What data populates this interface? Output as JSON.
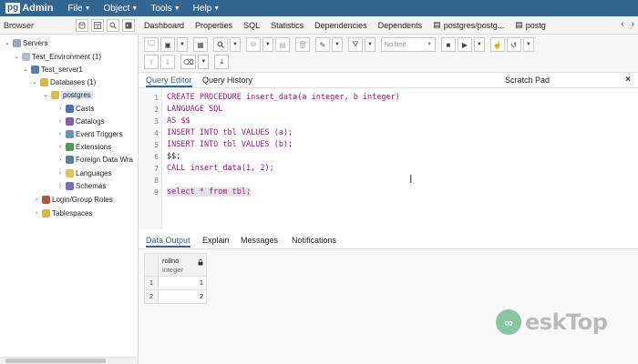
{
  "menubar": {
    "logo_pg": "pg",
    "logo_admin": "Admin",
    "items": [
      {
        "label": "File"
      },
      {
        "label": "Object"
      },
      {
        "label": "Tools"
      },
      {
        "label": "Help"
      }
    ]
  },
  "browser": {
    "title": "Browser",
    "tree": [
      {
        "label": "Servers"
      },
      {
        "label": "Test_Environment (1)"
      },
      {
        "label": "Test_server1"
      },
      {
        "label": "Databases (1)"
      },
      {
        "label": "postgres"
      },
      {
        "label": "Casts"
      },
      {
        "label": "Catalogs"
      },
      {
        "label": "Event Triggers"
      },
      {
        "label": "Extensions"
      },
      {
        "label": "Foreign Data Wra"
      },
      {
        "label": "Languages"
      },
      {
        "label": "Schemas"
      },
      {
        "label": "Login/Group Roles"
      },
      {
        "label": "Tablespaces"
      }
    ]
  },
  "tabbar": {
    "tabs": [
      {
        "label": "Dashboard"
      },
      {
        "label": "Properties"
      },
      {
        "label": "SQL"
      },
      {
        "label": "Statistics"
      },
      {
        "label": "Dependencies"
      },
      {
        "label": "Dependents"
      },
      {
        "label": "postgres/postg..."
      },
      {
        "label": "postg"
      }
    ]
  },
  "toolbar": {
    "limit_label": "No limit"
  },
  "query_tabs": {
    "editor": "Query Editor",
    "history": "Query History",
    "scratch": "Scratch Pad",
    "close": "×"
  },
  "editor": {
    "line_numbers": [
      "1",
      "2",
      "3",
      "4",
      "5",
      "6",
      "7",
      "8",
      "9"
    ],
    "lines": [
      "CREATE PROCEDURE insert_data(a integer, b integer)",
      "LANGUAGE SQL",
      "AS $$",
      "INSERT INTO tbl VALUES (a);",
      "INSERT INTO tbl VALUES (b);",
      "$$;",
      "CALL insert_data(1, 2);",
      "",
      "select * from tbl;"
    ]
  },
  "output_tabs": {
    "data_output": "Data Output",
    "explain": "Explain",
    "messages": "Messages",
    "notifications": "Notifications"
  },
  "result_grid": {
    "column_name": "rollno",
    "column_type": "integer",
    "rows": [
      {
        "num": "1",
        "value": "1"
      },
      {
        "num": "2",
        "value": "2"
      }
    ]
  },
  "watermark": {
    "text": "eskTop"
  },
  "colors": {
    "menubar": "#326690",
    "keyword": "#a3157b"
  }
}
